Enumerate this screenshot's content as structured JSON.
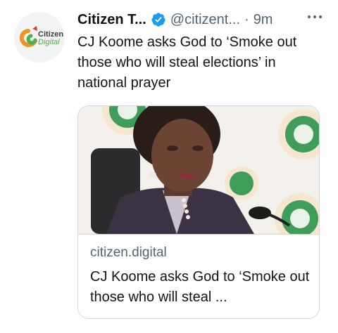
{
  "tweet": {
    "display_name": "Citizen T...",
    "handle": "@citizent...",
    "separator": "·",
    "time": "9m",
    "text": "CJ Koome asks God to ‘Smoke out those who will steal elections’ in national prayer",
    "avatar_logo_line1": "Citizen",
    "avatar_logo_line2": "Digital"
  },
  "card": {
    "domain": "citizen.digital",
    "title": "CJ Koome asks God to ‘Smoke out those who will steal ..."
  },
  "colors": {
    "verified": "#1d9bf0",
    "brand_orange": "#f29021",
    "brand_green": "#4caf50",
    "text_secondary": "#536471"
  },
  "icons": {
    "verified": "verified-badge-icon",
    "more": "more-horizontal-icon"
  }
}
